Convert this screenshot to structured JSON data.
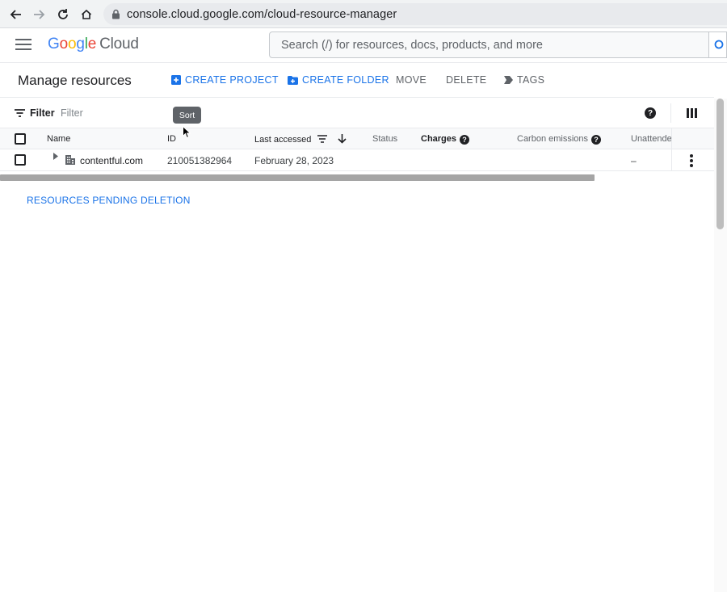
{
  "browser": {
    "url": "console.cloud.google.com/cloud-resource-manager"
  },
  "header": {
    "logo": {
      "google": "Google",
      "cloud": "Cloud"
    },
    "search_placeholder": "Search (/) for resources, docs, products, and more"
  },
  "toolbar": {
    "title": "Manage resources",
    "create_project": "CREATE PROJECT",
    "create_folder": "CREATE FOLDER",
    "move": "MOVE",
    "delete": "DELETE",
    "tags": "TAGS"
  },
  "filter": {
    "label": "Filter",
    "placeholder": "Filter"
  },
  "tooltip": "Sort",
  "table": {
    "columns": {
      "name": "Name",
      "id": "ID",
      "last_accessed": "Last accessed",
      "status": "Status",
      "charges": "Charges",
      "carbon": "Carbon emissions",
      "unattended": "Unattende"
    },
    "rows": [
      {
        "name": "contentful.com",
        "id": "210051382964",
        "last_accessed": "February 28, 2023",
        "unattended": "–"
      }
    ]
  },
  "pending_deletion": "RESOURCES PENDING DELETION",
  "colors": {
    "accent": "#1a73e8",
    "text": "#202124",
    "muted": "#5f6368"
  }
}
